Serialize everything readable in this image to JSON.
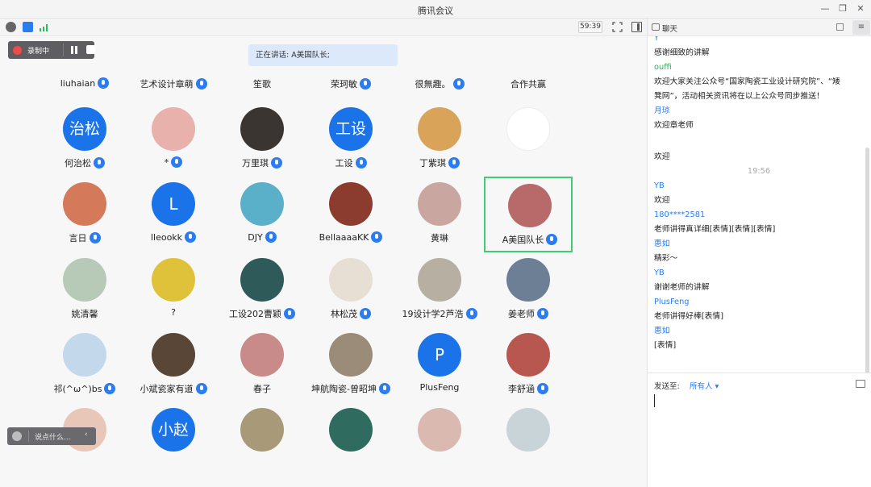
{
  "window": {
    "title": "腾讯会议"
  },
  "toolbar": {
    "timer": "59:39"
  },
  "recording": {
    "label": "录制中"
  },
  "speaking": {
    "text": "正在讲话: A美国队长;"
  },
  "say": {
    "placeholder": "说点什么..."
  },
  "top_names": [
    "liuhaian",
    "艺术设计章萌",
    "笙歌",
    "荣珂敏",
    "很無趣。",
    "合作共赢"
  ],
  "top_names_mic": [
    true,
    true,
    false,
    true,
    true,
    false
  ],
  "participants": [
    [
      {
        "name": "何治松",
        "avatar_text": "治松",
        "color": "#1a73e8",
        "mic": true
      },
      {
        "name": "*",
        "avatar_text": "",
        "color": "#e9b1ac",
        "mic": true
      },
      {
        "name": "万里琪",
        "avatar_text": "",
        "color": "#3a3530",
        "mic": true
      },
      {
        "name": "工设",
        "avatar_text": "工设",
        "color": "#1a73e8",
        "mic": true
      },
      {
        "name": "丁紫琪",
        "avatar_text": "",
        "color": "#d9a35a",
        "mic": true
      },
      {
        "name": "",
        "avatar_text": "",
        "color": "#ffffff",
        "mic": false
      }
    ],
    [
      {
        "name": "言日",
        "avatar_text": "",
        "color": "#d47a5a",
        "mic": true
      },
      {
        "name": "lleookk",
        "avatar_text": "L",
        "color": "#1a73e8",
        "mic": true
      },
      {
        "name": "DJY",
        "avatar_text": "",
        "color": "#5ab0c9",
        "mic": true
      },
      {
        "name": "BellaaaaKK",
        "avatar_text": "",
        "color": "#8c3b2f",
        "mic": true
      },
      {
        "name": "黄琳",
        "avatar_text": "",
        "color": "#c9a7a0",
        "mic": false
      },
      {
        "name": "A美国队长",
        "avatar_text": "",
        "color": "#b86a6a",
        "mic": true
      }
    ],
    [
      {
        "name": "姚清馨",
        "avatar_text": "",
        "color": "#b7c9b7",
        "mic": false
      },
      {
        "name": "?",
        "avatar_text": "",
        "color": "#e0c23a",
        "mic": false
      },
      {
        "name": "工设202曹颖",
        "avatar_text": "",
        "color": "#2f5a5a",
        "mic": true
      },
      {
        "name": "林松茂",
        "avatar_text": "",
        "color": "#e8dfd4",
        "mic": true
      },
      {
        "name": "19设计学2芦浩",
        "avatar_text": "",
        "color": "#b7b0a2",
        "mic": true
      },
      {
        "name": "姜老师",
        "avatar_text": "",
        "color": "#6d7f95",
        "mic": true
      }
    ],
    [
      {
        "name": "祁(^ω^)bs",
        "avatar_text": "",
        "color": "#c4d8ec",
        "mic": true
      },
      {
        "name": "小斌瓷家有道",
        "avatar_text": "",
        "color": "#5a4636",
        "mic": true
      },
      {
        "name": "春子",
        "avatar_text": "",
        "color": "#c98a8a",
        "mic": false
      },
      {
        "name": "坤航陶瓷-曾昭坤",
        "avatar_text": "",
        "color": "#9b8c7a",
        "mic": true
      },
      {
        "name": "PlusFeng",
        "avatar_text": "P",
        "color": "#1a73e8",
        "mic": false
      },
      {
        "name": "李舒涵",
        "avatar_text": "",
        "color": "#b8574f",
        "mic": true
      }
    ],
    [
      {
        "name": "",
        "avatar_text": "",
        "color": "#e8c6b8",
        "mic": false
      },
      {
        "name": "",
        "avatar_text": "小赵",
        "color": "#1a73e8",
        "mic": false
      },
      {
        "name": "",
        "avatar_text": "",
        "color": "#a89a78",
        "mic": false
      },
      {
        "name": "",
        "avatar_text": "",
        "color": "#2f6b5e",
        "mic": false
      },
      {
        "name": "",
        "avatar_text": "",
        "color": "#d9b9b0",
        "mic": false
      },
      {
        "name": "",
        "avatar_text": "",
        "color": "#c9d4d8",
        "mic": false
      }
    ]
  ],
  "chat": {
    "title": "聊天",
    "messages": [
      {
        "type": "sender",
        "text": "Y"
      },
      {
        "type": "text",
        "text": "感谢细致的讲解"
      },
      {
        "type": "sender-green",
        "text": "ouffi"
      },
      {
        "type": "text",
        "text": "欢迎大家关注公众号“国家陶瓷工业设计研究院”、“矮"
      },
      {
        "type": "text",
        "text": "凳网”，活动相关资讯将在以上公众号同步推送！"
      },
      {
        "type": "sender",
        "text": "月琼"
      },
      {
        "type": "text",
        "text": "欢迎章老师"
      },
      {
        "type": "blank",
        "text": ""
      },
      {
        "type": "text",
        "text": "欢迎"
      },
      {
        "type": "time",
        "text": "19:56"
      },
      {
        "type": "sender",
        "text": "YB"
      },
      {
        "type": "text",
        "text": "欢迎"
      },
      {
        "type": "sender",
        "text": "180****2581"
      },
      {
        "type": "text",
        "text": "老师讲得真详细[表情][表情][表情]"
      },
      {
        "type": "sender",
        "text": "惠如"
      },
      {
        "type": "text",
        "text": "精彩～"
      },
      {
        "type": "sender",
        "text": "YB"
      },
      {
        "type": "text",
        "text": "谢谢老师的讲解"
      },
      {
        "type": "sender",
        "text": "PlusFeng"
      },
      {
        "type": "text",
        "text": "老师讲得好棒[表情]"
      },
      {
        "type": "sender",
        "text": "惠如"
      },
      {
        "type": "text",
        "text": "[表情]"
      }
    ],
    "send_to_label": "发送至:",
    "send_target": "所有人"
  }
}
